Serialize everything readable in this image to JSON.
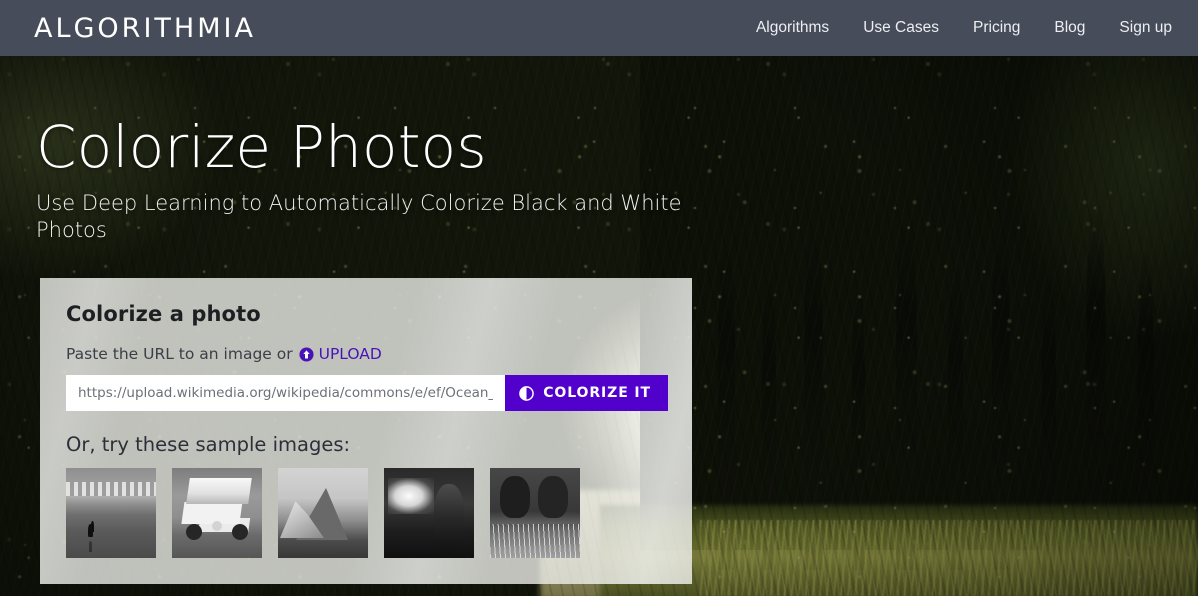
{
  "header": {
    "logo": "ALGORITHMIA",
    "nav": [
      {
        "label": "Algorithms"
      },
      {
        "label": "Use Cases"
      },
      {
        "label": "Pricing"
      },
      {
        "label": "Blog"
      },
      {
        "label": "Sign up"
      }
    ]
  },
  "hero": {
    "title": "Colorize Photos",
    "subtitle": "Use Deep Learning to Automatically Colorize Black and White Photos"
  },
  "card": {
    "title": "Colorize a photo",
    "label_text": "Paste the URL to an image or",
    "upload_label": "UPLOAD",
    "upload_icon": "upload-circle-icon",
    "url_value": "https://upload.wikimedia.org/wikipedia/commons/e/ef/Ocean_beach",
    "url_placeholder": "Paste the URL to an image",
    "button_label": "COLORIZE IT",
    "button_icon": "half-circle-contrast-icon",
    "button_color": "#5200CC",
    "samples_title": "Or, try these sample images:",
    "samples": [
      {
        "name": "beach-with-shorebird"
      },
      {
        "name": "sprint-race-car"
      },
      {
        "name": "half-dome-mountain"
      },
      {
        "name": "person-with-fire-smoke"
      },
      {
        "name": "two-cows-in-grass"
      }
    ]
  },
  "theme": {
    "header_bg": "#464C59",
    "accent": "#5200CC",
    "card_bg": "rgba(236,237,233,0.80)"
  },
  "background": {
    "description": "tree-lined dirt road with dark canopy"
  }
}
